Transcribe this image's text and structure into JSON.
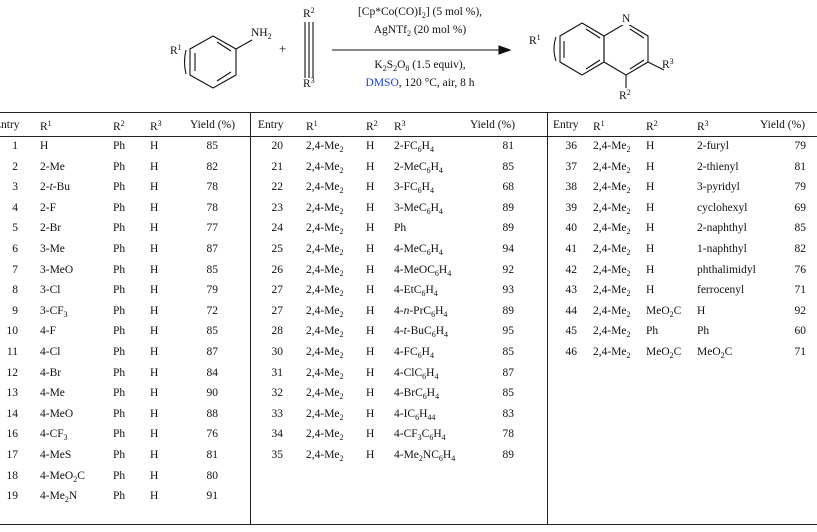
{
  "scheme": {
    "reactant_substituent": "R1",
    "reactant_group": "NH2",
    "plus": "+",
    "alkyne_r2": "R2",
    "alkyne_r3": "R3",
    "conditions_above": [
      "[Cp*Co(CO)I2] (5 mol %),",
      "AgNTf2 (20 mol %)"
    ],
    "conditions_below": [
      "K2S2O8 (1.5 equiv),",
      "DMSO, 120 °C, air, 8 h"
    ],
    "solvent_highlight": "DMSO",
    "product_n": "N",
    "product_r1": "R1",
    "product_r2": "R2",
    "product_r3": "R3"
  },
  "headers": [
    "Entry",
    "R1",
    "R2",
    "R3",
    "Yield (%)"
  ],
  "table": {
    "col1": [
      [
        "1",
        "H",
        "Ph",
        "H",
        "85"
      ],
      [
        "2",
        "2-Me",
        "Ph",
        "H",
        "82"
      ],
      [
        "3",
        "2-t-Bu",
        "Ph",
        "H",
        "78"
      ],
      [
        "4",
        "2-F",
        "Ph",
        "H",
        "78"
      ],
      [
        "5",
        "2-Br",
        "Ph",
        "H",
        "77"
      ],
      [
        "6",
        "3-Me",
        "Ph",
        "H",
        "87"
      ],
      [
        "7",
        "3-MeO",
        "Ph",
        "H",
        "85"
      ],
      [
        "8",
        "3-Cl",
        "Ph",
        "H",
        "79"
      ],
      [
        "9",
        "3-CF3",
        "Ph",
        "H",
        "72"
      ],
      [
        "10",
        "4-F",
        "Ph",
        "H",
        "85"
      ],
      [
        "11",
        "4-Cl",
        "Ph",
        "H",
        "87"
      ],
      [
        "12",
        "4-Br",
        "Ph",
        "H",
        "84"
      ],
      [
        "13",
        "4-Me",
        "Ph",
        "H",
        "90"
      ],
      [
        "14",
        "4-MeO",
        "Ph",
        "H",
        "88"
      ],
      [
        "16",
        "4-CF3",
        "Ph",
        "H",
        "76"
      ],
      [
        "17",
        "4-MeS",
        "Ph",
        "H",
        "81"
      ],
      [
        "18",
        "4-MeO2C",
        "Ph",
        "H",
        "80"
      ],
      [
        "19",
        "4-Me2N",
        "Ph",
        "H",
        "91"
      ]
    ],
    "col2": [
      [
        "20",
        "2,4-Me2",
        "H",
        "2-FC6H4",
        "81"
      ],
      [
        "21",
        "2,4-Me2",
        "H",
        "2-MeC6H4",
        "85"
      ],
      [
        "22",
        "2,4-Me2",
        "H",
        "3-FC6H4",
        "68"
      ],
      [
        "23",
        "2,4-Me2",
        "H",
        "3-MeC6H4",
        "89"
      ],
      [
        "24",
        "2,4-Me2",
        "H",
        "Ph",
        "89"
      ],
      [
        "25",
        "2,4-Me2",
        "H",
        "4-MeC6H4",
        "94"
      ],
      [
        "26",
        "2,4-Me2",
        "H",
        "4-MeOC6H4",
        "92"
      ],
      [
        "27",
        "2,4-Me2",
        "H",
        "4-EtC6H4",
        "93"
      ],
      [
        "27",
        "2,4-Me2",
        "H",
        "4-n-PrC6H4",
        "89"
      ],
      [
        "28",
        "2,4-Me2",
        "H",
        "4-t-BuC6H4",
        "95"
      ],
      [
        "30",
        "2,4-Me2",
        "H",
        "4-FC6H4",
        "85"
      ],
      [
        "31",
        "2,4-Me2",
        "H",
        "4-ClC6H4",
        "87"
      ],
      [
        "32",
        "2,4-Me2",
        "H",
        "4-BrC6H4",
        "85"
      ],
      [
        "33",
        "2,4-Me2",
        "H",
        "4-IC6H44",
        "83"
      ],
      [
        "34",
        "2,4-Me2",
        "H",
        "4-CF3C6H4",
        "78"
      ],
      [
        "35",
        "2,4-Me2",
        "H",
        "4-Me2NC6H4",
        "89"
      ]
    ],
    "col3": [
      [
        "36",
        "2,4-Me2",
        "H",
        "2-furyl",
        "79"
      ],
      [
        "37",
        "2,4-Me2",
        "H",
        "2-thienyl",
        "81"
      ],
      [
        "38",
        "2,4-Me2",
        "H",
        "3-pyridyl",
        "79"
      ],
      [
        "39",
        "2,4-Me2",
        "H",
        "cyclohexyl",
        "69"
      ],
      [
        "40",
        "2,4-Me2",
        "H",
        "2-naphthyl",
        "85"
      ],
      [
        "41",
        "2,4-Me2",
        "H",
        "1-naphthyl",
        "82"
      ],
      [
        "42",
        "2,4-Me2",
        "H",
        "phthalimidyl",
        "76"
      ],
      [
        "43",
        "2,4-Me2",
        "H",
        "ferrocenyl",
        "71"
      ],
      [
        "44",
        "2,4-Me2",
        "MeO2C",
        "H",
        "92"
      ],
      [
        "45",
        "2,4-Me2",
        "Ph",
        "Ph",
        "60"
      ],
      [
        "46",
        "2,4-Me2",
        "MeO2C",
        "MeO2C",
        "71"
      ]
    ]
  }
}
